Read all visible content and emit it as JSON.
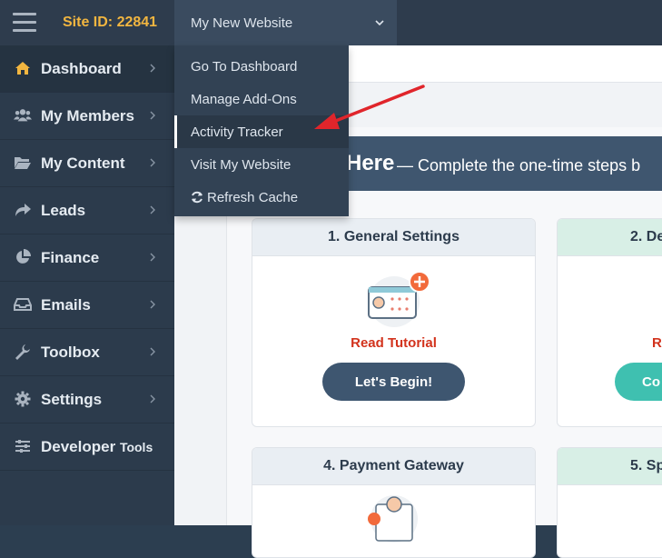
{
  "topbar": {
    "site_id": "Site ID: 22841",
    "website_select": "My New Website"
  },
  "sidebar": {
    "items": [
      {
        "label": "Dashboard",
        "icon": "home-icon"
      },
      {
        "label": "My Members",
        "icon": "users-icon"
      },
      {
        "label": "My Content",
        "icon": "folder-icon"
      },
      {
        "label": "Leads",
        "icon": "share-icon"
      },
      {
        "label": "Finance",
        "icon": "pie-chart-icon"
      },
      {
        "label": "Emails",
        "icon": "inbox-icon"
      },
      {
        "label": "Toolbox",
        "icon": "wrench-icon"
      },
      {
        "label": "Settings",
        "icon": "gear-icon"
      },
      {
        "label": "Developer",
        "label_suffix": "Tools",
        "icon": "sliders-icon"
      }
    ]
  },
  "dropdown": {
    "items": [
      {
        "label": "Go To Dashboard"
      },
      {
        "label": "Manage Add-Ons"
      },
      {
        "label": "Activity Tracker"
      },
      {
        "label": "Visit My Website"
      },
      {
        "label": "Refresh Cache",
        "icon": "refresh-icon"
      }
    ]
  },
  "banner": {
    "title": "Here",
    "subtitle": "— Complete the one-time steps b"
  },
  "cards": [
    {
      "title": "1. General Settings",
      "tutorial": "Read Tutorial",
      "button": "Let's Begin!"
    },
    {
      "title": "2. De",
      "tutorial": "R",
      "button": "Co"
    },
    {
      "title": "4. Payment Gateway"
    },
    {
      "title": "5. Sp"
    }
  ],
  "colors": {
    "sidebar_bg": "#2c3b4c",
    "accent_yellow": "#f2b640",
    "tutorial_red": "#d2321c",
    "button_navy": "#3e5670",
    "button_teal": "#3fc0b0",
    "annotation_arrow": "#e0252b"
  }
}
